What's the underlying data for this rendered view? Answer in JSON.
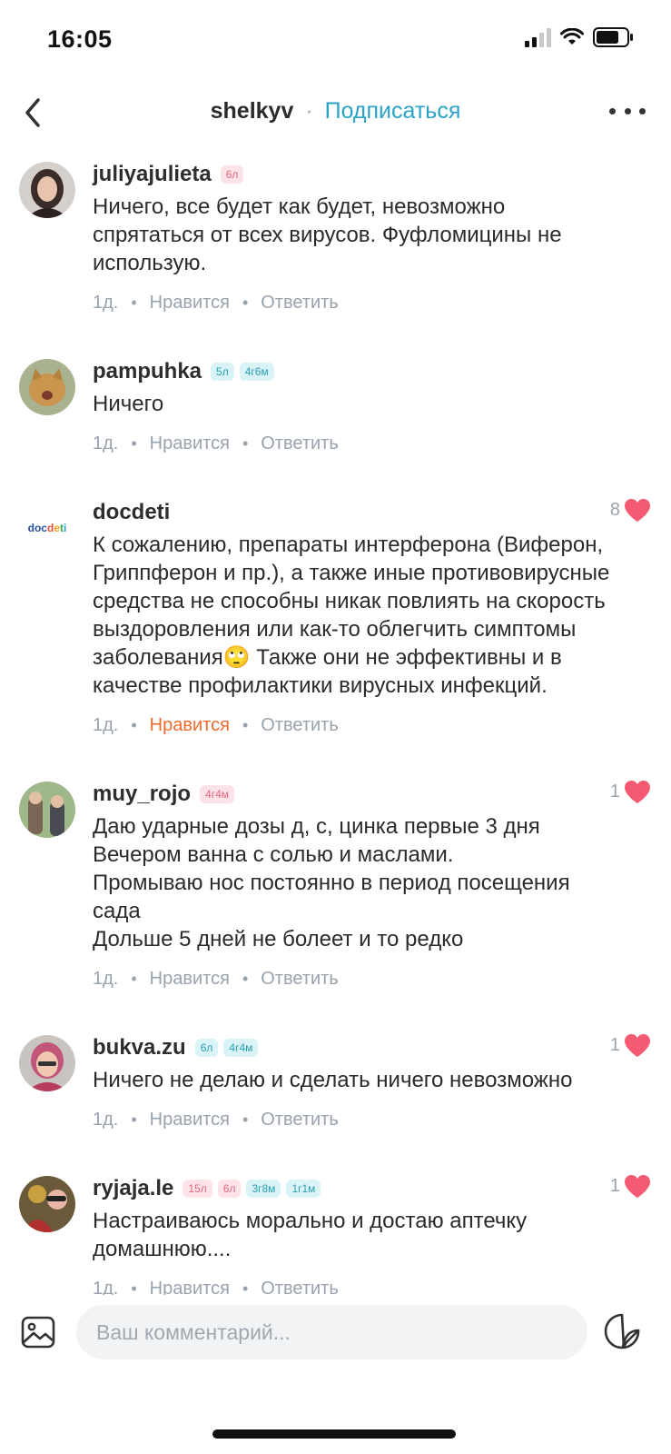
{
  "status_bar": {
    "time": "16:05"
  },
  "header": {
    "username": "shelkyv",
    "separator": "·",
    "follow_label": "Подписаться"
  },
  "comments": [
    {
      "username": "juliyajulieta",
      "badges": [
        {
          "text": "6л",
          "color": "pink"
        }
      ],
      "text": "Ничего, все будет как будет, невозможно спрятаться от всех вирусов.  Фуфломицины не использую.",
      "time": "1д.",
      "like_label": "Нравится",
      "liked": false,
      "reply_label": "Ответить",
      "likes": ""
    },
    {
      "username": "pampuhka",
      "badges": [
        {
          "text": "5л",
          "color": "blue"
        },
        {
          "text": "4г6м",
          "color": "blue"
        }
      ],
      "text": "Ничего",
      "time": "1д.",
      "like_label": "Нравится",
      "liked": false,
      "reply_label": "Ответить",
      "likes": ""
    },
    {
      "username": "docdeti",
      "badges": [],
      "text": "К сожалению, препараты интерферона (Виферон, Гриппферон и пр.), а также иные противовирусные средства не способны никак повлиять на скорость выздоровления или как-то облегчить симптомы заболевания🙄 Также они не эффективны и в качестве профилактики вирусных инфекций.",
      "time": "1д.",
      "like_label": "Нравится",
      "liked": true,
      "reply_label": "Ответить",
      "likes": "8"
    },
    {
      "username": "muy_rojo",
      "badges": [
        {
          "text": "4г4м",
          "color": "pink"
        }
      ],
      "text": "Даю ударные дозы д, с, цинка первые 3 дня\nВечером ванна с солью и маслами.\nПромываю нос постоянно в период посещения сада\nДольше 5 дней не болеет и то редко",
      "time": "1д.",
      "like_label": "Нравится",
      "liked": false,
      "reply_label": "Ответить",
      "likes": "1"
    },
    {
      "username": "bukva.zu",
      "badges": [
        {
          "text": "6л",
          "color": "blue"
        },
        {
          "text": "4г4м",
          "color": "blue"
        }
      ],
      "text": "Ничего не делаю и сделать ничего невозможно",
      "time": "1д.",
      "like_label": "Нравится",
      "liked": false,
      "reply_label": "Ответить",
      "likes": "1"
    },
    {
      "username": "ryjaja.le",
      "badges": [
        {
          "text": "15л",
          "color": "pink"
        },
        {
          "text": "6л",
          "color": "pink"
        },
        {
          "text": "3г8м",
          "color": "blue"
        },
        {
          "text": "1г1м",
          "color": "blue"
        }
      ],
      "text": "Настраиваюсь морально и достаю аптечку домашнюю....",
      "time": "1д.",
      "like_label": "Нравится",
      "liked": false,
      "reply_label": "Ответить",
      "likes": "1"
    }
  ],
  "composer": {
    "placeholder": "Ваш комментарий..."
  },
  "colors": {
    "accent": "#2aa3c8",
    "heart": "#f45a72",
    "liked": "#ee6a2c"
  }
}
